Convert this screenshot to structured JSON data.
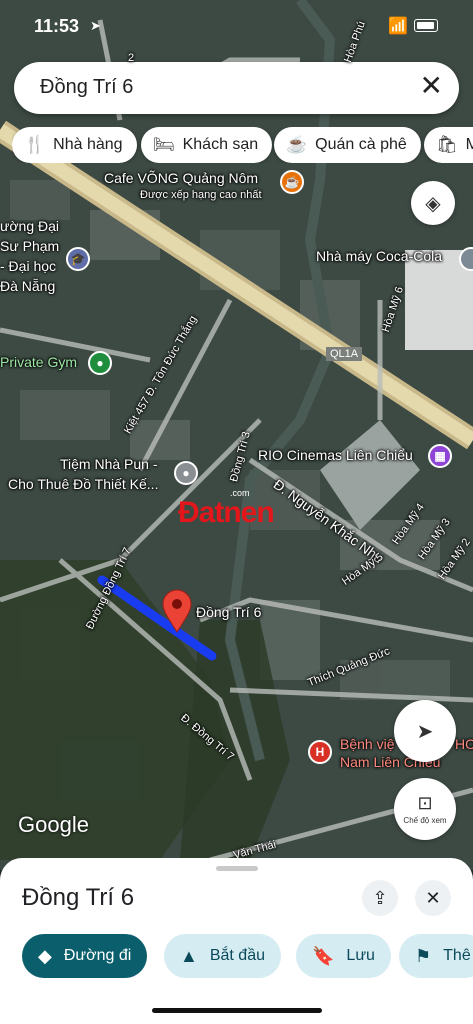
{
  "status": {
    "time": "11:53"
  },
  "search": {
    "query": "Đồng Trí 6"
  },
  "chips": [
    {
      "icon": "🍴",
      "label": "Nhà hàng"
    },
    {
      "icon": "🛏",
      "label": "Khách sạn"
    },
    {
      "icon": "☕",
      "label": "Quán cà phê"
    },
    {
      "icon": "🛍",
      "label": "M"
    }
  ],
  "map": {
    "labels": {
      "cafe_name": "Cafe VÕNG Quảng Nôm",
      "cafe_sub": "Được xếp hạng cao nhất",
      "university_1": "ường Đại",
      "university_2": "Sư Phạm",
      "university_3": "- Đại học",
      "university_4": "Đà Nẵng",
      "coca_cola": "Nhà máy Coca-Cola",
      "gym": "Private Gym",
      "hoa_my_6": "Hòa Mỹ 6",
      "ql1a": "QL1A",
      "kiet": "Kiệt 457 Đ. Tôn Đức Thắng",
      "rio": "RIO Cinemas Liên Chiểu",
      "tiem_1": "Tiệm Nhà Pun -",
      "tiem_2": "Cho Thuê Đồ Thiết Kế...",
      "tri3": "Đồng Trí 3",
      "nguyen_khac_nhu": "Đ. Nguyễn Khắc Nhu",
      "hoa_my_4": "Hòa Mỹ 4",
      "hoa_my_3": "Hòa Mỹ 3",
      "hoa_my_2": "Hòa Mỹ 2",
      "hoa_my_5": "Hòa Mỹ 5",
      "duong_dong_tri_7": "Đường Đồng Trí 7",
      "dong_tri_6": "Đồng Trí 6",
      "thich_quang_duc": "Thích Quảng Đức",
      "d_dong_tri_7": "Đ. Đồng Trí 7",
      "hospital_1": "Bệnh việ",
      "hospital_1b": "HOA",
      "hospital_2": "Nam Liên Chiểu",
      "van_thai": "Văn Thái",
      "hoa_phu": "Hòa Phú",
      "street_2": "2"
    },
    "watermark": "Đatnen",
    "watermark_small": ".com",
    "street_view_label": "Chế độ xem",
    "google": "Google",
    "route_color": "#1a3cf0",
    "pin_color": "#ea4335"
  },
  "sheet": {
    "title": "Đồng Trí 6",
    "actions": [
      {
        "icon": "◆",
        "label": "Đường đi"
      },
      {
        "icon": "▲",
        "label": "Bắt đầu"
      },
      {
        "icon": "🔖",
        "label": "Lưu"
      },
      {
        "icon": "⚑",
        "label": "Thê"
      }
    ]
  }
}
